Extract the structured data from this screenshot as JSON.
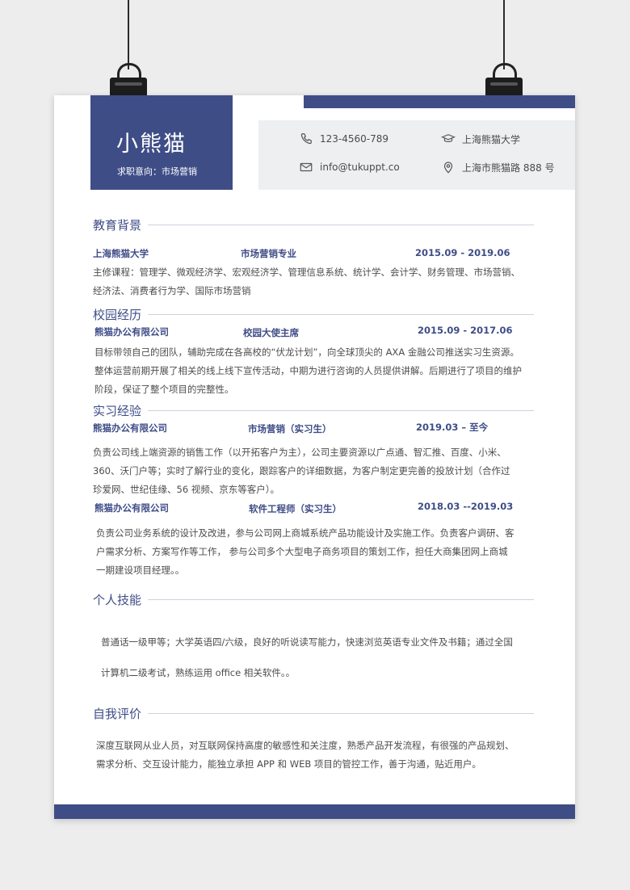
{
  "header": {
    "name": "小熊猫",
    "intent": "求职意向：市场营销"
  },
  "contact": {
    "phone": "123-4560-789",
    "email": "info@tukuppt.co",
    "school": "上海熊猫大学",
    "address": "上海市熊猫路 888 号"
  },
  "education": {
    "title": "教育背景",
    "school": "上海熊猫大学",
    "major": "市场营销专业",
    "period": "2015.09 - 2019.06",
    "courses": [
      "主修课程：管理学、微观经济学、宏观经济学、管理信息系统、统计学、会计学、财务管理、市场营销、",
      "经济法、消费者行为学、国际市场营销"
    ]
  },
  "campus": {
    "title": "校园经历",
    "company": "熊猫办公有限公司",
    "role": "校园大使主席",
    "period": "2015.09 - 2017.06",
    "lines": [
      "目标带领自己的团队，辅助完成在各高校的“伏龙计划”，向全球顶尖的 AXA 金融公司推送实习生资源。",
      "整体运营前期开展了相关的线上线下宣传活动，中期为进行咨询的人员提供讲解。后期进行了项目的维护",
      "阶段，保证了整个项目的完整性。"
    ]
  },
  "internship": {
    "title": "实习经验",
    "items": [
      {
        "company": "熊猫办公有限公司",
        "role": "市场营销（实习生）",
        "period": "2019.03 – 至今",
        "lines": [
          "负责公司线上端资源的销售工作（以开拓客户为主），公司主要资源以广点通、智汇推、百度、小米、",
          "360、沃门户等；实时了解行业的变化，跟踪客户的详细数据，为客户制定更完善的投放计划（合作过",
          "珍爱网、世纪佳缘、56 视频、京东等客户）。"
        ]
      },
      {
        "company": "熊猫办公有限公司",
        "role": "软件工程师（实习生）",
        "period": "2018.03 --2019.03",
        "lines": [
          "负责公司业务系统的设计及改进，参与公司网上商城系统产品功能设计及实施工作。负责客户调研、客",
          "户需求分析、方案写作等工作，  参与公司多个大型电子商务项目的策划工作，担任大商集团网上商城",
          "一期建设项目经理。。"
        ]
      }
    ]
  },
  "skills": {
    "title": "个人技能",
    "lines": [
      "普通话一级甲等；大学英语四/六级，良好的听说读写能力，快速浏览英语专业文件及书籍；通过全国",
      "计算机二级考试，熟练运用 office 相关软件。。"
    ]
  },
  "self_eval": {
    "title": "自我评价",
    "lines": [
      "深度互联网从业人员，对互联网保持高度的敏感性和关注度，熟悉产品开发流程，有很强的产品规划、",
      "需求分析、交互设计能力，能独立承担 APP 和 WEB 项目的管控工作，善于沟通，贴近用户。"
    ]
  },
  "icons": [
    "phone-icon",
    "email-icon",
    "graduation-cap-icon",
    "location-pin-icon"
  ],
  "colors": {
    "accent": "#3f4d87",
    "contact_bg": "#eeeff1"
  }
}
